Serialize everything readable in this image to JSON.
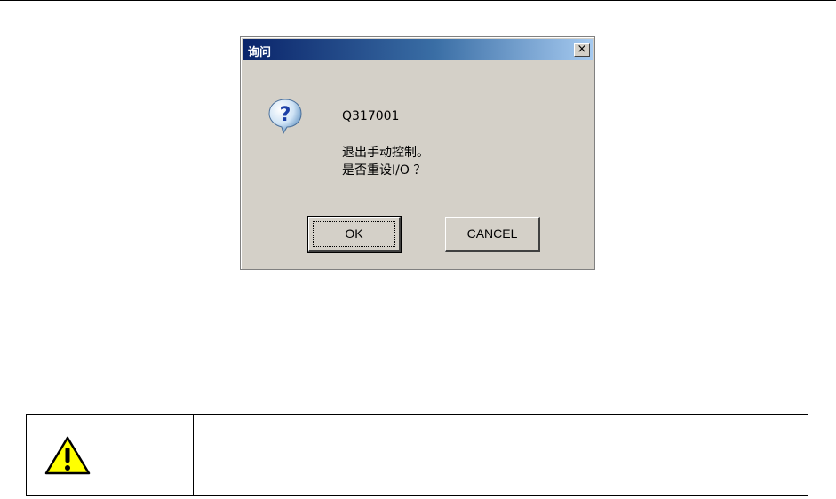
{
  "dialog": {
    "title": "询问",
    "close_label": "×",
    "message_code": "Q317001",
    "message_line1": "退出手动控制。",
    "message_line2": "是否重设I/O ？",
    "ok_label": "OK",
    "cancel_label": "CANCEL",
    "icon": "question-icon"
  },
  "warning_box": {
    "icon": "warning-icon",
    "text": ""
  },
  "colors": {
    "dialog_bg": "#d4d0c8",
    "title_start": "#0a246a",
    "title_end": "#a6caf0",
    "warning_yellow": "#ffff00"
  }
}
